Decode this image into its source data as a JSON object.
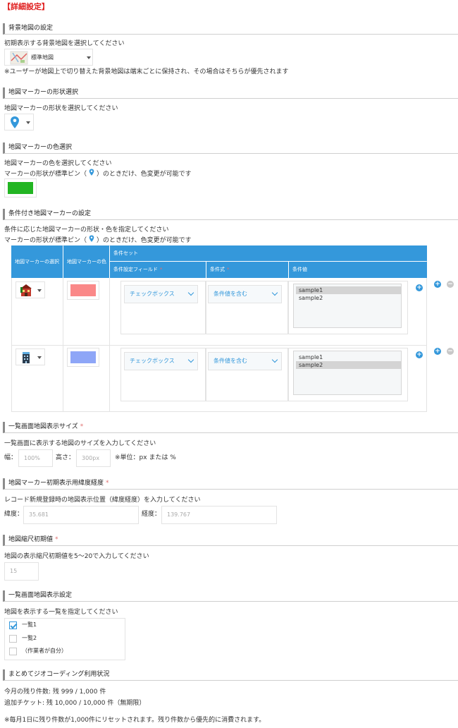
{
  "page_title": "【詳細設定】",
  "colors": {
    "accent": "#3498db",
    "title_red": "#e01e1e",
    "default_marker_color": "#22b522",
    "rule1_color": "#fa8888",
    "rule2_color": "#8ea6f7"
  },
  "basemap": {
    "heading": "背景地図の設定",
    "desc": "初期表示する背景地図を選択してください",
    "selected": "標準地図",
    "note": "※ユーザーが地図上で切り替えた背景地図は端末ごとに保持され、その場合はそちらが優先されます",
    "icon": "map-thumbnail-icon"
  },
  "marker_shape": {
    "heading": "地図マーカーの形状選択",
    "desc": "地図マーカーの形状を選択してください",
    "icon": "map-pin-icon"
  },
  "marker_color": {
    "heading": "地図マーカーの色選択",
    "desc1": "地図マーカーの色を選択してください",
    "desc2_pre": "マーカーの形状が標準ピン（",
    "desc2_post": "）のときだけ、色変更が可能です"
  },
  "conditional": {
    "heading": "条件付き地図マーカーの設定",
    "desc1": "条件に応じた地図マーカーの形状・色を指定してください",
    "desc2_pre": "マーカーの形状が標準ピン（",
    "desc2_post": "）のときだけ、色変更が可能です",
    "headers": {
      "marker_select": "地図マーカーの選択",
      "marker_color": "地図マーカーの色",
      "condition_set": "条件セット",
      "field": "条件設定フィールド",
      "operator": "条件式",
      "value": "条件値"
    },
    "rows": [
      {
        "icon": "store-building-icon",
        "field": "チェックボックス",
        "operator": "条件値を含む",
        "options": [
          "sample1",
          "sample2"
        ],
        "selected_index": 0
      },
      {
        "icon": "office-building-icon",
        "field": "チェックボックス",
        "operator": "条件値を含む",
        "options": [
          "sample1",
          "sample2"
        ],
        "selected_index": 1
      }
    ]
  },
  "list_size": {
    "heading": "一覧画面地図表示サイズ",
    "desc": "一覧画面に表示する地図のサイズを入力してください",
    "width_label": "幅：",
    "width_value": "100%",
    "height_label": "高さ：",
    "height_value": "300px",
    "unit_note": "※単位：px または %"
  },
  "initial_position": {
    "heading": "地図マーカー初期表示用緯度経度",
    "desc": "レコード新規登録時の地図表示位置（緯度経度）を入力してください",
    "lat_label": "緯度：",
    "lat_value": "35.681",
    "lng_label": "経度：",
    "lng_value": "139.767"
  },
  "zoom": {
    "heading": "地図縮尺初期値",
    "desc": "地図の表示縮尺初期値を5～20で入力してください",
    "value": "15"
  },
  "list_display": {
    "heading": "一覧画面地図表示設定",
    "desc": "地図を表示する一覧を指定してください",
    "items": [
      {
        "label": "一覧1",
        "checked": true
      },
      {
        "label": "一覧2",
        "checked": false
      },
      {
        "label": "（作業者が自分）",
        "checked": false
      }
    ]
  },
  "geocoding": {
    "heading": "まとめてジオコーディング利用状況",
    "remaining": "今月の残り件数: 残 999 / 1,000 件",
    "tickets": "追加チケット: 残 10,000 / 10,000 件（無期限）",
    "note": "※毎月1日に残り件数が1,000件にリセットされます。残り件数から優先的に消費されます。"
  },
  "required_mark": "*"
}
